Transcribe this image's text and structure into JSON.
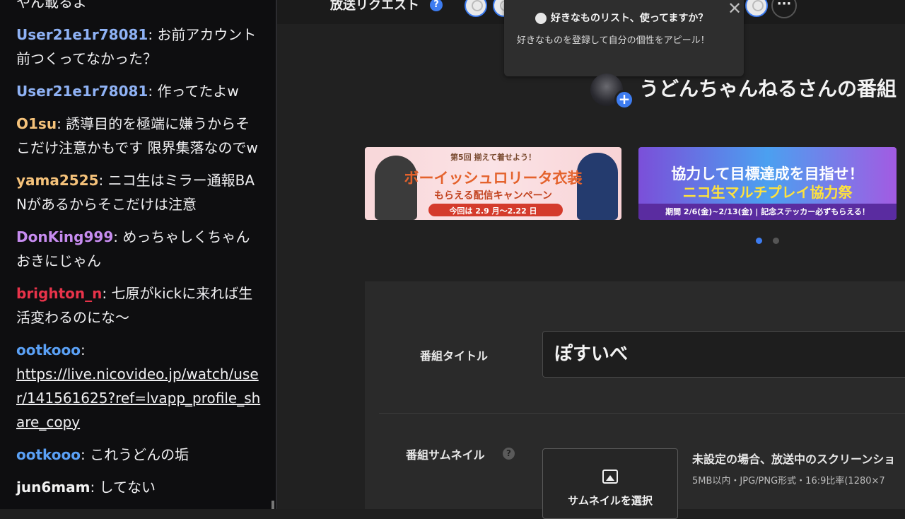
{
  "colors": {
    "accent": "#3d7cf0",
    "chat_bg": "#0e0e10",
    "page_bg": "#212121"
  },
  "chat": {
    "messages": [
      {
        "user": "",
        "user_color": "#efeff1",
        "text": "やん載るよ",
        "link": ""
      },
      {
        "user": "User21e1r78081",
        "user_color": "#8fb2f5",
        "text": "お前アカウント前つくってなかった？",
        "link": ""
      },
      {
        "user": "User21e1r78081",
        "user_color": "#8fb2f5",
        "text": "作ってたよw",
        "link": ""
      },
      {
        "user": "O1su",
        "user_color": "#f5c27a",
        "text": "誘導目的を極端に嫌うからそこだけ注意かもです 限界集落なのでw",
        "link": ""
      },
      {
        "user": "yama2525",
        "user_color": "#f5c27a",
        "text": "ニコ生はミラー通報BANがあるからそこだけは注意",
        "link": ""
      },
      {
        "user": "DonKing999",
        "user_color": "#c78cf0",
        "text": "めっちゃしくちゃんおきにじゃん",
        "link": ""
      },
      {
        "user": "brighton_n",
        "user_color": "#e8334a",
        "text": "七原がkickに来れば生活変わるのにな〜",
        "link": ""
      },
      {
        "user": "ootkooo",
        "user_color": "#5aa0f5",
        "text": "",
        "link": "https://live.nicovideo.jp/watch/user/141561625?ref=lvapp_profile_share_copy"
      },
      {
        "user": "ootkooo",
        "user_color": "#5aa0f5",
        "text": "これうどんの垢",
        "link": ""
      },
      {
        "user": "jun6mam",
        "user_color": "#f2f2f2",
        "text": "してない",
        "link": ""
      }
    ]
  },
  "header": {
    "request_title": "放送リクエスト",
    "help_icon": "question-circle-icon",
    "more_label": "···"
  },
  "tooltip": {
    "title": "好きなものリスト、使ってますか？",
    "body": "好きなものを登録して自分の個性をアピール！",
    "close": "✕"
  },
  "channel": {
    "title": "うどんちゃんねるさんの番組",
    "follow_plus": "+"
  },
  "banners": {
    "b1": {
      "tag": "第5回 揃えて着せよう！",
      "main": "ボーイッシュロリータ衣装",
      "sub": "もらえる配信キャンペーン",
      "date": "今回は 2.9 月〜2.22 日"
    },
    "b2": {
      "main": "協力して目標達成を目指せ！",
      "sub": "ニコ生マルチプレイ協力祭",
      "date": "期間 2/6(金)~2/13(金) | 記念ステッカー必ずもらえる！"
    }
  },
  "carousel": {
    "current": 1,
    "total": 2
  },
  "form": {
    "title_label": "番組タイトル",
    "title_value": "ぽすいべ",
    "thumb_label": "番組サムネイル",
    "thumb_help": "?",
    "thumb_button": "サムネイルを選択",
    "thumb_note1": "未設定の場合、放送中のスクリーンショ",
    "thumb_note2": "5MB以内・JPG/PNG形式・16:9比率(1280×7"
  }
}
